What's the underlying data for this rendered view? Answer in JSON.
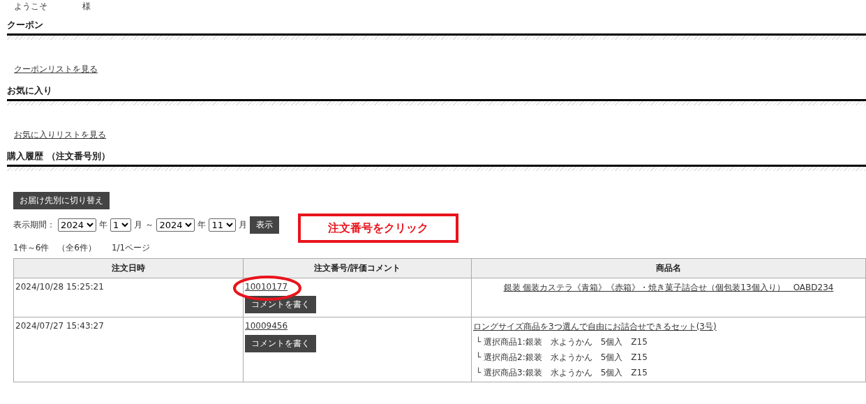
{
  "welcome": {
    "greeting": "ようこそ",
    "honorific": "様"
  },
  "sections": [
    {
      "title": "クーポン",
      "link": "クーポンリストを見る"
    },
    {
      "title": "お気に入り",
      "link": "お気に入りリストを見る"
    }
  ],
  "history": {
    "title": "購入履歴 （注文番号別）",
    "switch_button": "お届け先別に切り替え",
    "period": {
      "label": "表示期間：",
      "from_year": "2024",
      "from_year_unit": "年",
      "from_month": "1",
      "from_month_unit": "月",
      "tilde": "～",
      "to_year": "2024",
      "to_year_unit": "年",
      "to_month": "11",
      "to_month_unit": "月",
      "show_button": "表示"
    },
    "count": "1件～6件　（全6件）",
    "pages": "1/1ページ",
    "columns": [
      "注文日時",
      "注文番号/評価コメント",
      "商品名"
    ],
    "rows": [
      {
        "date": "2024/10/28 15:25:21",
        "order_number": "10010177",
        "circled": true,
        "comment_button": "コメントを書く",
        "product": "銀装 個装カステラ《青箱》《赤箱》・焼き菓子詰合せ（個包装13個入り）　OABD234",
        "options": []
      },
      {
        "date": "2024/07/27 15:43:27",
        "order_number": "10009456",
        "circled": false,
        "comment_button": "コメントを書く",
        "product": "ロングサイズ商品を3つ選んで自由にお詰合せできるセット(3号)",
        "options": [
          "└ 選択商品1:銀装　水ようかん　5個入　Z15",
          "└ 選択商品2:銀装　水ようかん　5個入　Z15",
          "└ 選択商品3:銀装　水ようかん　5個入　Z15"
        ]
      }
    ]
  },
  "annotation": {
    "callout": "注文番号をクリック"
  }
}
